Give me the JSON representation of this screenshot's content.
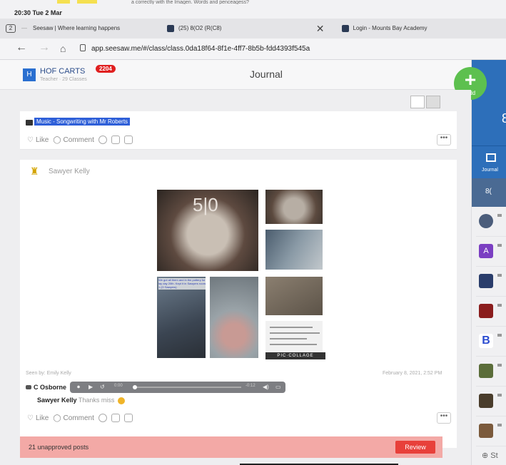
{
  "status_bar": {
    "time": "20:30  Tue 2 Mar",
    "top_snippet": "a correctly with the Imagen. Words and penceagess?"
  },
  "tabs": [
    {
      "label": "Seesaw | Where learning happens",
      "active": false
    },
    {
      "label": "(25) 8(O2 (R(C8)",
      "active": true
    },
    {
      "label": "Login - Mounts Bay Academy",
      "active": false
    }
  ],
  "tab_counter": "2",
  "url": "app.seesaw.me/#/class/class.0da18f64-8f1e-4ff7-8b5b-fdd4393f545a",
  "header": {
    "class_initial": "H",
    "class_name": "HOF CARTS",
    "class_sub": "Teacher · 29 Classes",
    "badge": "2204",
    "title": "Journal"
  },
  "add_button": {
    "label": "Add"
  },
  "right_panel": {
    "big_number": "8",
    "journal_label": "Journal",
    "selected_row": "8(",
    "students": [
      {
        "icon": "student-avatar-photo",
        "color": "#4b5d7b"
      },
      {
        "icon": "letter-A-avatar",
        "color": "#7b3fc2",
        "letter": "A"
      },
      {
        "icon": "student-avatar-photo",
        "color": "#2a3d6b"
      },
      {
        "icon": "student-avatar-photo",
        "color": "#8a1d1d"
      },
      {
        "icon": "letter-B-avatar",
        "color": "#ffffff",
        "letter": "B"
      },
      {
        "icon": "student-avatar-photo",
        "color": "#5b6d3a"
      },
      {
        "icon": "student-avatar-photo",
        "color": "#4a3d2c"
      },
      {
        "icon": "student-avatar-photo",
        "color": "#7b5a3c"
      }
    ],
    "add_student": "⊕ St"
  },
  "post1": {
    "folder_label": "Music - Songwriting with Mr Roberts",
    "like": "Like",
    "comment": "Comment"
  },
  "post2": {
    "author": "Sawyer Kelly",
    "cake_number": "5|0",
    "caption_overlay": "We got all them and in the pottery for lay day 20th. Kept it in Sawyers room. 1 (O Sawyers)",
    "collage_brand": "PIC·COLLAGE",
    "seen_by": "Seen by: Emily Kelly",
    "date": "February 8, 2021, 2:52 PM",
    "comment_author": "C Osborne",
    "audio_time_start": "0:00",
    "audio_time_end": "-0:12",
    "reply_author": "Sawyer Kelly",
    "reply_text": "Thanks miss",
    "like": "Like",
    "comment": "Comment"
  },
  "banner": {
    "text": "21 unapproved posts",
    "button": "Review"
  }
}
